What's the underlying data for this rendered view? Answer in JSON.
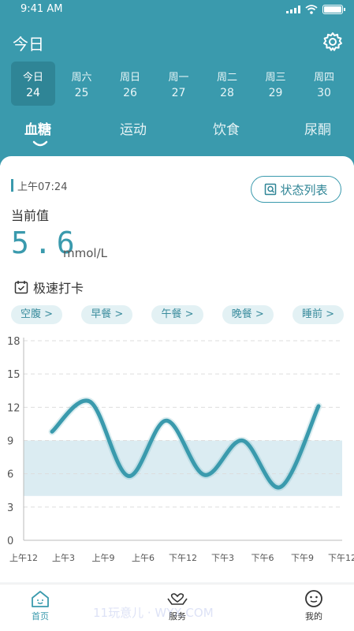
{
  "status": {
    "time": "9:41 AM"
  },
  "header": {
    "title": "今日"
  },
  "days": [
    {
      "label": "今日",
      "num": "24",
      "active": true
    },
    {
      "label": "周六",
      "num": "25"
    },
    {
      "label": "周日",
      "num": "26"
    },
    {
      "label": "周一",
      "num": "27"
    },
    {
      "label": "周二",
      "num": "28"
    },
    {
      "label": "周三",
      "num": "29"
    },
    {
      "label": "周四",
      "num": "30"
    }
  ],
  "tabs": [
    "血糖",
    "运动",
    "饮食",
    "尿酮"
  ],
  "card": {
    "time": "上午07:24",
    "status_list_label": "状态列表",
    "current_label": "当前值",
    "value": "5.6",
    "unit": "mmol/L",
    "quick_label": "极速打卡"
  },
  "meals": [
    "空腹 >",
    "早餐 >",
    "午餐 >",
    "晚餐 >",
    "睡前 >"
  ],
  "chart_data": {
    "type": "line",
    "x": [
      "上午12",
      "上午3",
      "上午9",
      "上午6",
      "下午12",
      "下午3",
      "下午6",
      "下午9",
      "下午12"
    ],
    "y_ticks": [
      0,
      3,
      6,
      9,
      12,
      15,
      18
    ],
    "ylim": [
      0,
      18
    ],
    "target_range": [
      4,
      9
    ],
    "series": [
      {
        "values": [
          9.8,
          12.5,
          5.8,
          10.8,
          5.9,
          9.0,
          4.8,
          12.1
        ]
      }
    ],
    "colors": {
      "line": "#3a9aad",
      "band": "#cfe6ee"
    }
  },
  "nav": [
    {
      "label": "首页",
      "icon": "home-icon",
      "active": true
    },
    {
      "label": "服务",
      "icon": "service-icon"
    },
    {
      "label": "我的",
      "icon": "profile-icon"
    }
  ],
  "watermark": "11玩意儿 · WYX.COM"
}
